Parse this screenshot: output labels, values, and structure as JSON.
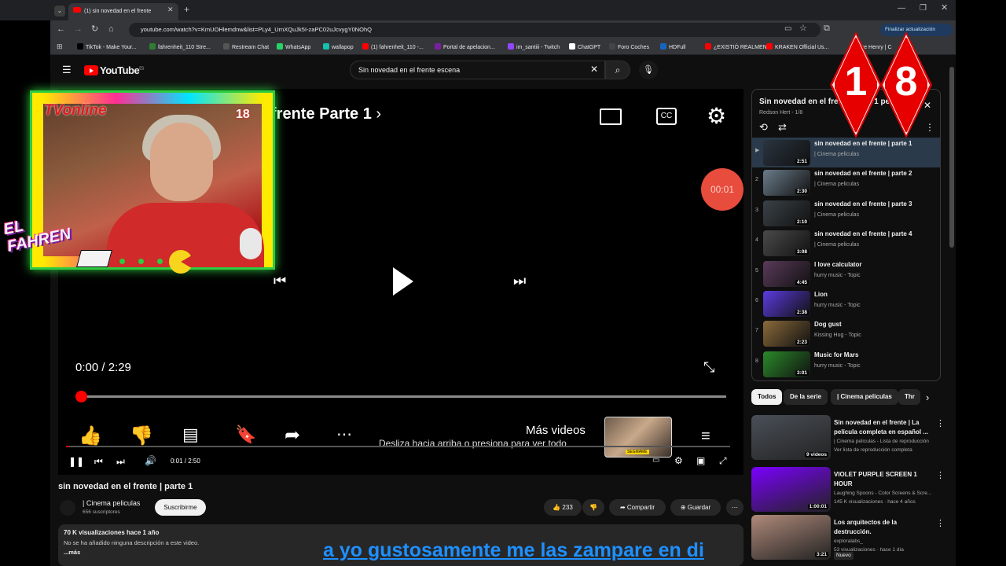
{
  "browser": {
    "tab_title": "(1) sin novedad en el frente",
    "url": "youtube.com/watch?v=KmUOHlemdnw&list=PLy4_UrnXQuJk5I-zaPC02uJcvygY0NOhQ",
    "update_button": "Finalizar actualización",
    "bookmarks": [
      {
        "label": "TikTok - Make Your...",
        "color": "#000000"
      },
      {
        "label": "fahrenheit_110 Stre...",
        "color": "#2e7d32"
      },
      {
        "label": "Restream Chat",
        "color": "#555555"
      },
      {
        "label": "WhatsApp",
        "color": "#25d366"
      },
      {
        "label": "wallapop",
        "color": "#13c1ac"
      },
      {
        "label": "(1) fahrenheit_110 -...",
        "color": "#ff0000"
      },
      {
        "label": "Portal de apelacion...",
        "color": "#7b1fa2"
      },
      {
        "label": "im_santiii - Twitch",
        "color": "#9146ff"
      },
      {
        "label": "ChatGPT",
        "color": "#ffffff"
      },
      {
        "label": "Foro Coches",
        "color": "#444444"
      },
      {
        "label": "HDFull",
        "color": "#1565c0"
      },
      {
        "label": "¿EXISTIÓ REALMEN...",
        "color": "#ff0000"
      },
      {
        "label": "KRAKEN Official Us...",
        "color": "#ff0000"
      },
      {
        "label": "ore Henry | C",
        "color": "#ff0000"
      }
    ]
  },
  "youtube": {
    "logo": "YouTube",
    "logo_region": "ES",
    "search_query": "Sin novedad en el frente escena"
  },
  "player": {
    "overlay_title": "frente Parte 1",
    "timer": "00:01",
    "current_time": "0:00 / 2:29",
    "mas_videos": "Más videos",
    "desliza": "Desliza hacia arriba o presiona para ver todo",
    "card_label": "SEGMAME",
    "control_time": "0:01 / 2:50",
    "progress": 0.003
  },
  "video": {
    "title": "sin novedad en el frente | parte 1",
    "channel": "| Cinema peliculas",
    "subscribers": "656 suscriptores",
    "subscribe": "Suscribirme",
    "likes": "233",
    "share": "Compartir",
    "save": "Guardar",
    "views_line": "70 K visualizaciones  hace 1 año",
    "description": "No se ha añadido ninguna descripción a este video.",
    "more": "...más",
    "caption": "a yo gustosamente me las zampare en di"
  },
  "playlist": {
    "title": "Sin novedad en el frente Parte 1 película",
    "owner": "Redson Hert - 1/8",
    "items": [
      {
        "num": "▶",
        "title": "sin novedad en el frente | parte 1",
        "channel": "| Cinema peliculas",
        "duration": "2:51",
        "color": "#2a3440"
      },
      {
        "num": "2",
        "title": "sin novedad en el frente | parte 2",
        "channel": "| Cinema peliculas",
        "duration": "2:30",
        "color": "#6a7c8a"
      },
      {
        "num": "3",
        "title": "sin novedad en el frente | parte 3",
        "channel": "| Cinema peliculas",
        "duration": "2:10",
        "color": "#3a4248"
      },
      {
        "num": "4",
        "title": "sin novedad en el frente | parte 4",
        "channel": "| Cinema peliculas",
        "duration": "3:08",
        "color": "#4a4a4a"
      },
      {
        "num": "5",
        "title": "I love calculator",
        "channel": "hurry music - Topic",
        "duration": "4:45",
        "color": "#5a3a5a"
      },
      {
        "num": "6",
        "title": "Lion",
        "channel": "hurry music - Topic",
        "duration": "2:38",
        "color": "#5b3be0"
      },
      {
        "num": "7",
        "title": "Dog gust",
        "channel": "Kissing Hug - Topic",
        "duration": "2:23",
        "color": "#8a6a3a"
      },
      {
        "num": "8",
        "title": "Music for Mars",
        "channel": "hurry music - Topic",
        "duration": "3:01",
        "color": "#2a8a2a"
      }
    ]
  },
  "chips": [
    "Todos",
    "De la serie",
    "| Cinema peliculas",
    "Thr"
  ],
  "recommended": [
    {
      "title": "Sin novedad en el frente | La película completa en español ...",
      "meta1": "| Cinema peliculas - Lista de reproducción",
      "meta2": "Ver lista de reproducción completa",
      "badge": "9 videos",
      "color": "#4a5058"
    },
    {
      "title": "VIOLET PURPLE SCREEN 1 HOUR",
      "meta1": "Laughing Spoons - Color Screens & Scre...",
      "meta2": "145 K visualizaciones · hace 4 años",
      "badge": "1:00:01",
      "color": "#7b00ff"
    },
    {
      "title": "Los arquitectos de la destrucción.",
      "meta1": "exploralabs_",
      "meta2": "53 visualizaciones · hace 1 día",
      "badge": "3:21",
      "color": "#b08a7a",
      "tag": "Nuevo"
    }
  ],
  "overlay": {
    "cam_brand": "TVonline",
    "cam_age": "18",
    "streamer": "EL FAHREN",
    "rating_left": "1",
    "rating_right": "8"
  }
}
